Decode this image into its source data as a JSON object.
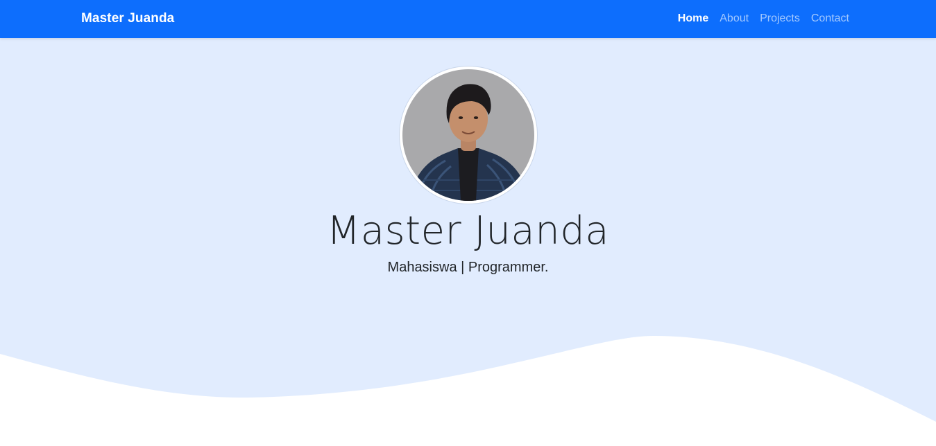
{
  "navbar": {
    "brand": "Master Juanda",
    "links": [
      {
        "label": "Home",
        "active": true
      },
      {
        "label": "About",
        "active": false
      },
      {
        "label": "Projects",
        "active": false
      },
      {
        "label": "Contact",
        "active": false
      }
    ],
    "background_color": "#0d6efd"
  },
  "hero": {
    "name": "Master Juanda",
    "tagline": "Mahasiswa | Programmer.",
    "background_color": "#e1ecfe",
    "avatar_icon": "profile-photo"
  }
}
